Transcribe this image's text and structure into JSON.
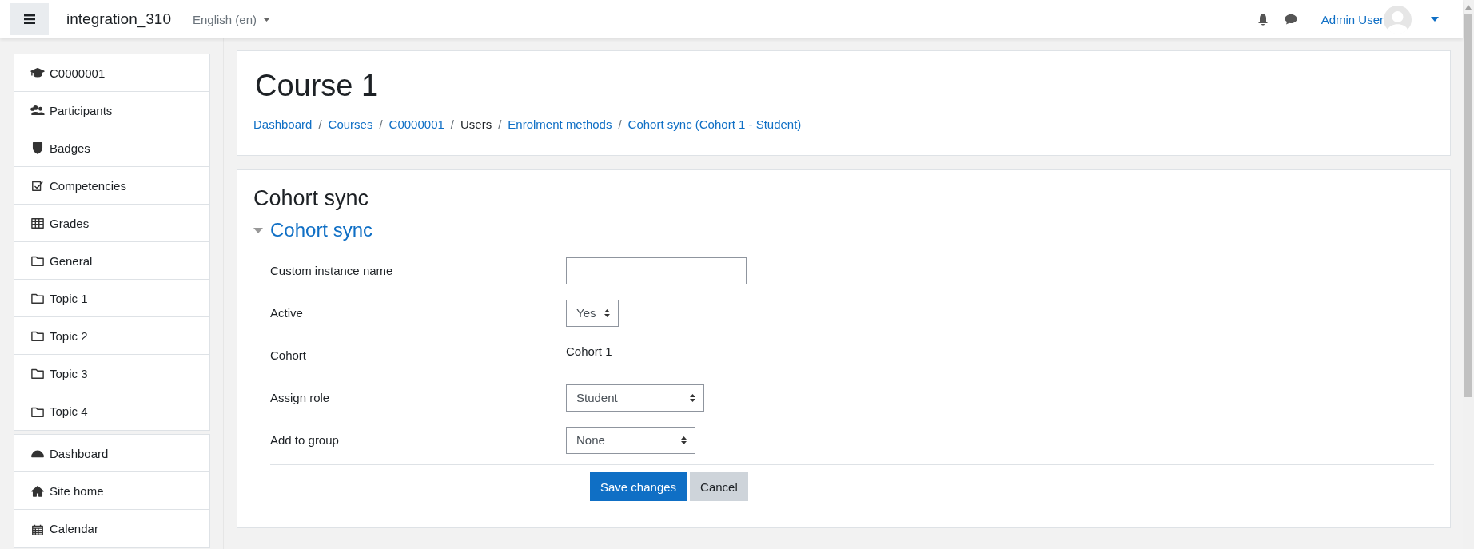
{
  "navbar": {
    "site_name": "integration_310",
    "language": "English (en)",
    "user_name": "Admin User"
  },
  "sidebar": {
    "course_items": [
      {
        "label": "C0000001"
      },
      {
        "label": "Participants"
      },
      {
        "label": "Badges"
      },
      {
        "label": "Competencies"
      },
      {
        "label": "Grades"
      },
      {
        "label": "General"
      },
      {
        "label": "Topic 1"
      },
      {
        "label": "Topic 2"
      },
      {
        "label": "Topic 3"
      },
      {
        "label": "Topic 4"
      }
    ],
    "site_items": [
      {
        "label": "Dashboard"
      },
      {
        "label": "Site home"
      },
      {
        "label": "Calendar"
      }
    ]
  },
  "header": {
    "title": "Course 1",
    "breadcrumb_separator": "/",
    "breadcrumb": [
      {
        "label": "Dashboard",
        "link": true
      },
      {
        "label": "Courses",
        "link": true
      },
      {
        "label": "C0000001",
        "link": true
      },
      {
        "label": "Users",
        "link": false
      },
      {
        "label": "Enrolment methods",
        "link": true
      },
      {
        "label": "Cohort sync (Cohort 1 - Student)",
        "link": true
      }
    ]
  },
  "form": {
    "heading": "Cohort sync",
    "section": {
      "title": "Cohort sync",
      "expanded": true
    },
    "fields": [
      {
        "kind": "text",
        "label": "Custom instance name"
      },
      {
        "kind": "select",
        "label": "Active",
        "value": "Yes"
      },
      {
        "kind": "static",
        "label": "Cohort",
        "value": "Cohort 1"
      },
      {
        "kind": "select",
        "label": "Assign role",
        "value": "Student"
      },
      {
        "kind": "select",
        "label": "Add to group",
        "value": "None"
      }
    ],
    "buttons": [
      {
        "label": "Save changes",
        "kind": "primary"
      },
      {
        "label": "Cancel",
        "kind": "secondary"
      }
    ]
  }
}
